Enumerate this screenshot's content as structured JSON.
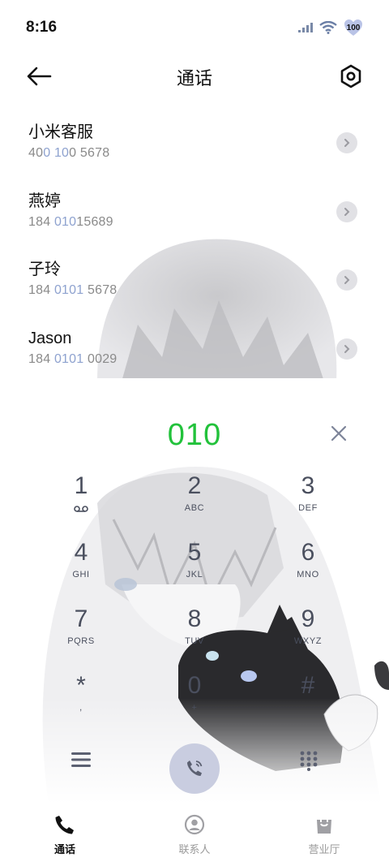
{
  "status_bar": {
    "time": "8:16",
    "battery": "100",
    "icons": [
      "signal-icon",
      "wifi-icon",
      "battery-icon"
    ]
  },
  "header": {
    "title": "通话",
    "back_icon": "back-arrow-icon",
    "settings_icon": "settings-hexagon-icon"
  },
  "contacts": [
    {
      "name": "小米客服",
      "number_parts": [
        "40",
        "0 10",
        "0 5678"
      ]
    },
    {
      "name": "燕婷",
      "number_parts": [
        "184 ",
        "010",
        "15689"
      ]
    },
    {
      "name": "子玲",
      "number_parts": [
        "184 ",
        "0101",
        " 5678"
      ]
    },
    {
      "name": "Jason",
      "number_parts": [
        "184 ",
        "0101",
        " 0029"
      ]
    }
  ],
  "dialer": {
    "dialed_number": "010",
    "clear_icon": "close-icon"
  },
  "keypad": [
    [
      {
        "digit": "1",
        "letters": ""
      },
      {
        "digit": "2",
        "letters": "ABC"
      },
      {
        "digit": "3",
        "letters": "DEF"
      }
    ],
    [
      {
        "digit": "4",
        "letters": "GHI"
      },
      {
        "digit": "5",
        "letters": "JKL"
      },
      {
        "digit": "6",
        "letters": "MNO"
      }
    ],
    [
      {
        "digit": "7",
        "letters": "PQRS"
      },
      {
        "digit": "8",
        "letters": "TUV"
      },
      {
        "digit": "9",
        "letters": "WXYZ"
      }
    ],
    [
      {
        "digit": "*",
        "letters": ","
      },
      {
        "digit": "0",
        "letters": "+"
      },
      {
        "digit": "#",
        "letters": ""
      }
    ]
  ],
  "actions": {
    "menu_icon": "menu-icon",
    "call_icon": "dual-sim-call-icon",
    "dialpad_icon": "dialpad-icon"
  },
  "bottom_nav": [
    {
      "label": "通话",
      "icon": "phone-icon",
      "active": true
    },
    {
      "label": "联系人",
      "icon": "contacts-icon",
      "active": false
    },
    {
      "label": "营业厅",
      "icon": "store-bag-icon",
      "active": false
    }
  ],
  "colors": {
    "accent_green": "#22c23b",
    "highlight_blue": "#8ea2cf",
    "call_button": "#c9cde0",
    "key_text": "#4a4f5e"
  }
}
